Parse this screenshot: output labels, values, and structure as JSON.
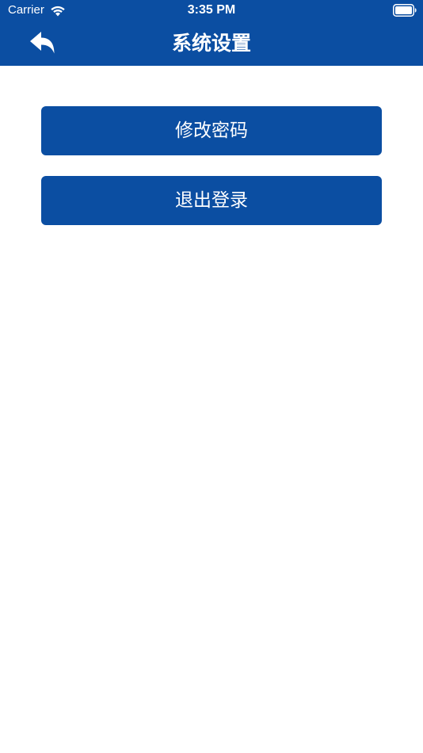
{
  "status_bar": {
    "carrier": "Carrier",
    "time": "3:35 PM",
    "wifi_icon": "wifi-icon",
    "battery_icon": "battery-full-icon"
  },
  "nav_bar": {
    "title": "系统设置",
    "back_icon": "reply-arrow-icon"
  },
  "buttons": {
    "change_password": "修改密码",
    "logout": "退出登录"
  },
  "colors": {
    "primary": "#0b4ea2",
    "background": "#ffffff",
    "text_on_primary": "#ffffff"
  }
}
